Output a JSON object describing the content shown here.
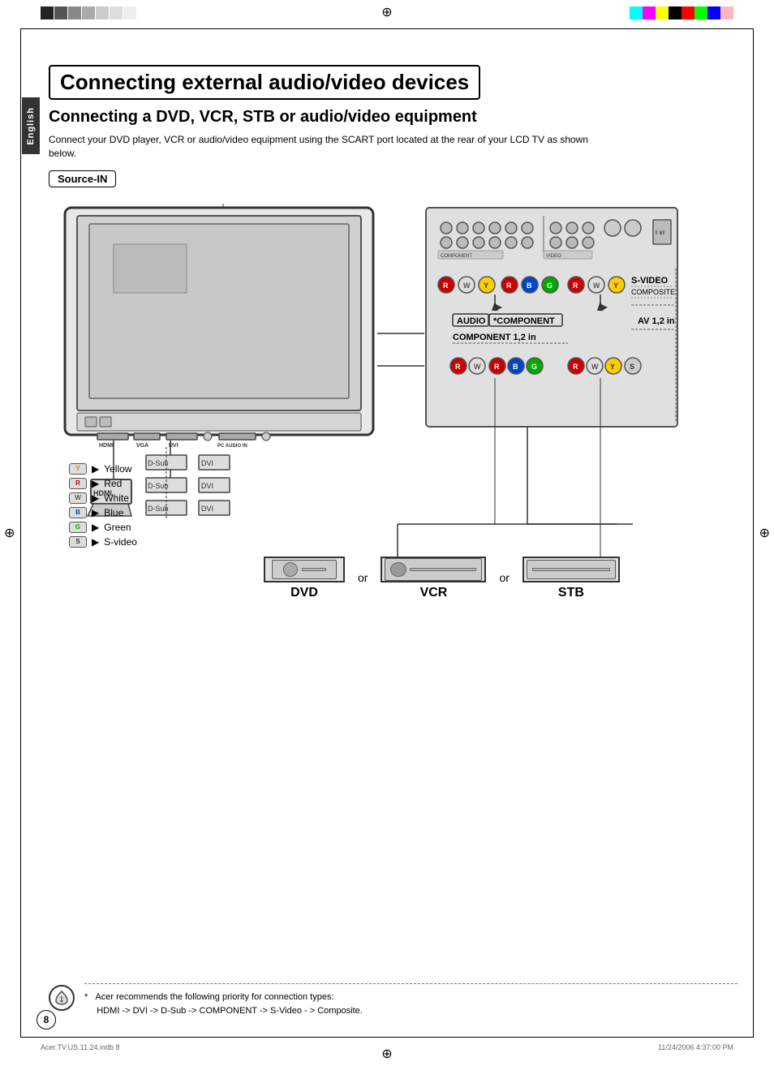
{
  "page": {
    "title": "Connecting external audio/video devices",
    "subtitle": "Connecting a DVD, VCR, STB or audio/video equipment",
    "description": "Connect your DVD player, VCR or audio/video equipment using the SCART port located at the rear of your LCD TV as shown below.",
    "source_in_label": "Source-IN",
    "english_tab": "English",
    "page_number": "8",
    "file_info": "Acer.TV.US.11.24.indb  8",
    "date_info": "11/24/2006   4:37:00 PM"
  },
  "connectors": {
    "hdmi_label": "HDMI",
    "dsub_label": "D-Sub",
    "dvi_label": "DVI",
    "component_label": "COMPONENT 1,2 in",
    "av_label": "AV 1,2 in",
    "audio_label": "AUDIO",
    "component_star": "*COMPONENT",
    "svideo_label": "S-VIDEO",
    "composite_label": "COMPOSITE"
  },
  "legend": {
    "items": [
      {
        "code": "Y",
        "color": "Yellow",
        "label": "Yellow"
      },
      {
        "code": "R",
        "color": "Red",
        "label": "Red"
      },
      {
        "code": "W",
        "color": "White",
        "label": "White"
      },
      {
        "code": "B",
        "color": "Blue",
        "label": "Blue"
      },
      {
        "code": "G",
        "color": "Green",
        "label": "Green"
      },
      {
        "code": "S",
        "color": "SVideo",
        "label": "S-video"
      }
    ]
  },
  "devices": [
    {
      "label": "DVD"
    },
    {
      "label": "VCR"
    },
    {
      "label": "STB"
    }
  ],
  "note": {
    "asterisk": "*",
    "line1": "Acer recommends the following priority for connection types:",
    "line2": "HDMI -> DVI -> D-Sub -> COMPONENT -> S-Video - > Composite."
  },
  "connector_rows": {
    "top": "D-Sub    DVI",
    "mid": "D-Sub    DVI",
    "bot": "D-Sub    DVI"
  },
  "port_labels": {
    "pc_audio": "PC AUDIO IN",
    "vga": "VGA",
    "dvi": "DVI",
    "hdmi": "HDMI"
  }
}
